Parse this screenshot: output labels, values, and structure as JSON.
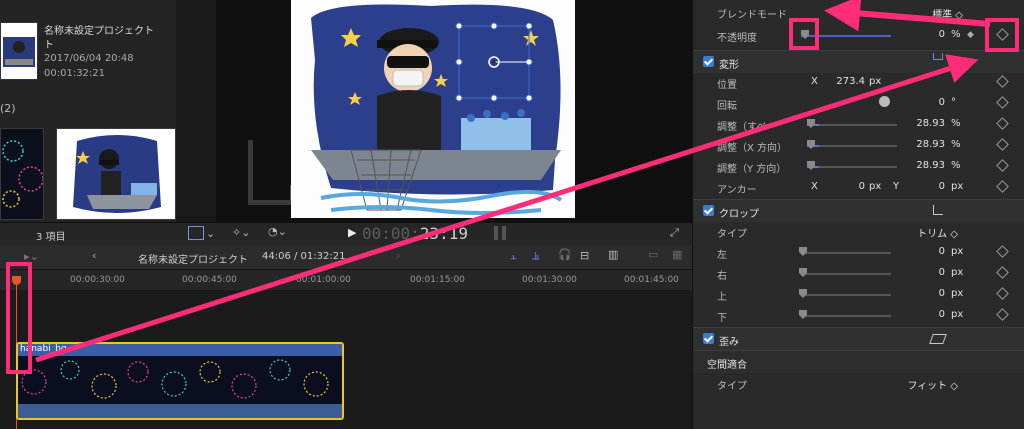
{
  "browser": {
    "project_name_line1": "名称未設定プロジェクト",
    "project_name_line2": "ト",
    "project_date": "2017/06/04 20:48",
    "project_duration": "00:01:32:21",
    "group_count": "(2)",
    "items_count": "3 項目"
  },
  "viewer": {
    "timecode": "00:00:23:19",
    "timecode_dim": "00:00:",
    "timecode_bright": "23:19"
  },
  "timeline": {
    "project_title": "名称未設定プロジェクト",
    "position": "44:06 / 01:32:21",
    "ruler_marks": [
      "00:00:30:00",
      "00:00:45:00",
      "00:01:00:00",
      "00:01:15:00",
      "00:01:30:00",
      "00:01:45:00"
    ],
    "clip_name": "hanabi_bg"
  },
  "inspector": {
    "blend_mode_label": "ブレンドモード",
    "blend_mode_value": "標準 ◇",
    "opacity_label": "不透明度",
    "opacity_value": "0",
    "opacity_unit": "%",
    "transform_title": "変形",
    "position_label": "位置",
    "position_x_label": "X",
    "position_x_value": "273.4",
    "position_unit": "px",
    "rotation_label": "回転",
    "rotation_value": "0",
    "rotation_unit": "°",
    "scale_all_label": "調整（すべ",
    "scale_all_value": "28.93",
    "scale_x_label": "調整（X 方向）",
    "scale_x_value": "28.93",
    "scale_y_label": "調整（Y 方向）",
    "scale_y_value": "28.93",
    "scale_unit": "%",
    "anchor_label": "アンカー",
    "anchor_x_label": "X",
    "anchor_x_value": "0",
    "anchor_y_label": "Y",
    "anchor_y_value": "0",
    "anchor_unit": "px",
    "crop_title": "クロップ",
    "crop_type_label": "タイプ",
    "crop_type_value": "トリム ◇",
    "crop_left_label": "左",
    "crop_right_label": "右",
    "crop_top_label": "上",
    "crop_bottom_label": "下",
    "crop_value": "0",
    "crop_unit": "px",
    "distort_title": "歪み",
    "spatial_title": "空間適合",
    "spatial_type_label": "タイプ",
    "spatial_type_value": "フィット ◇"
  },
  "colors": {
    "highlight": "#ff2d78",
    "accent": "#5b74d8",
    "clip_border": "#f0c419",
    "playhead": "#e05a2a"
  }
}
